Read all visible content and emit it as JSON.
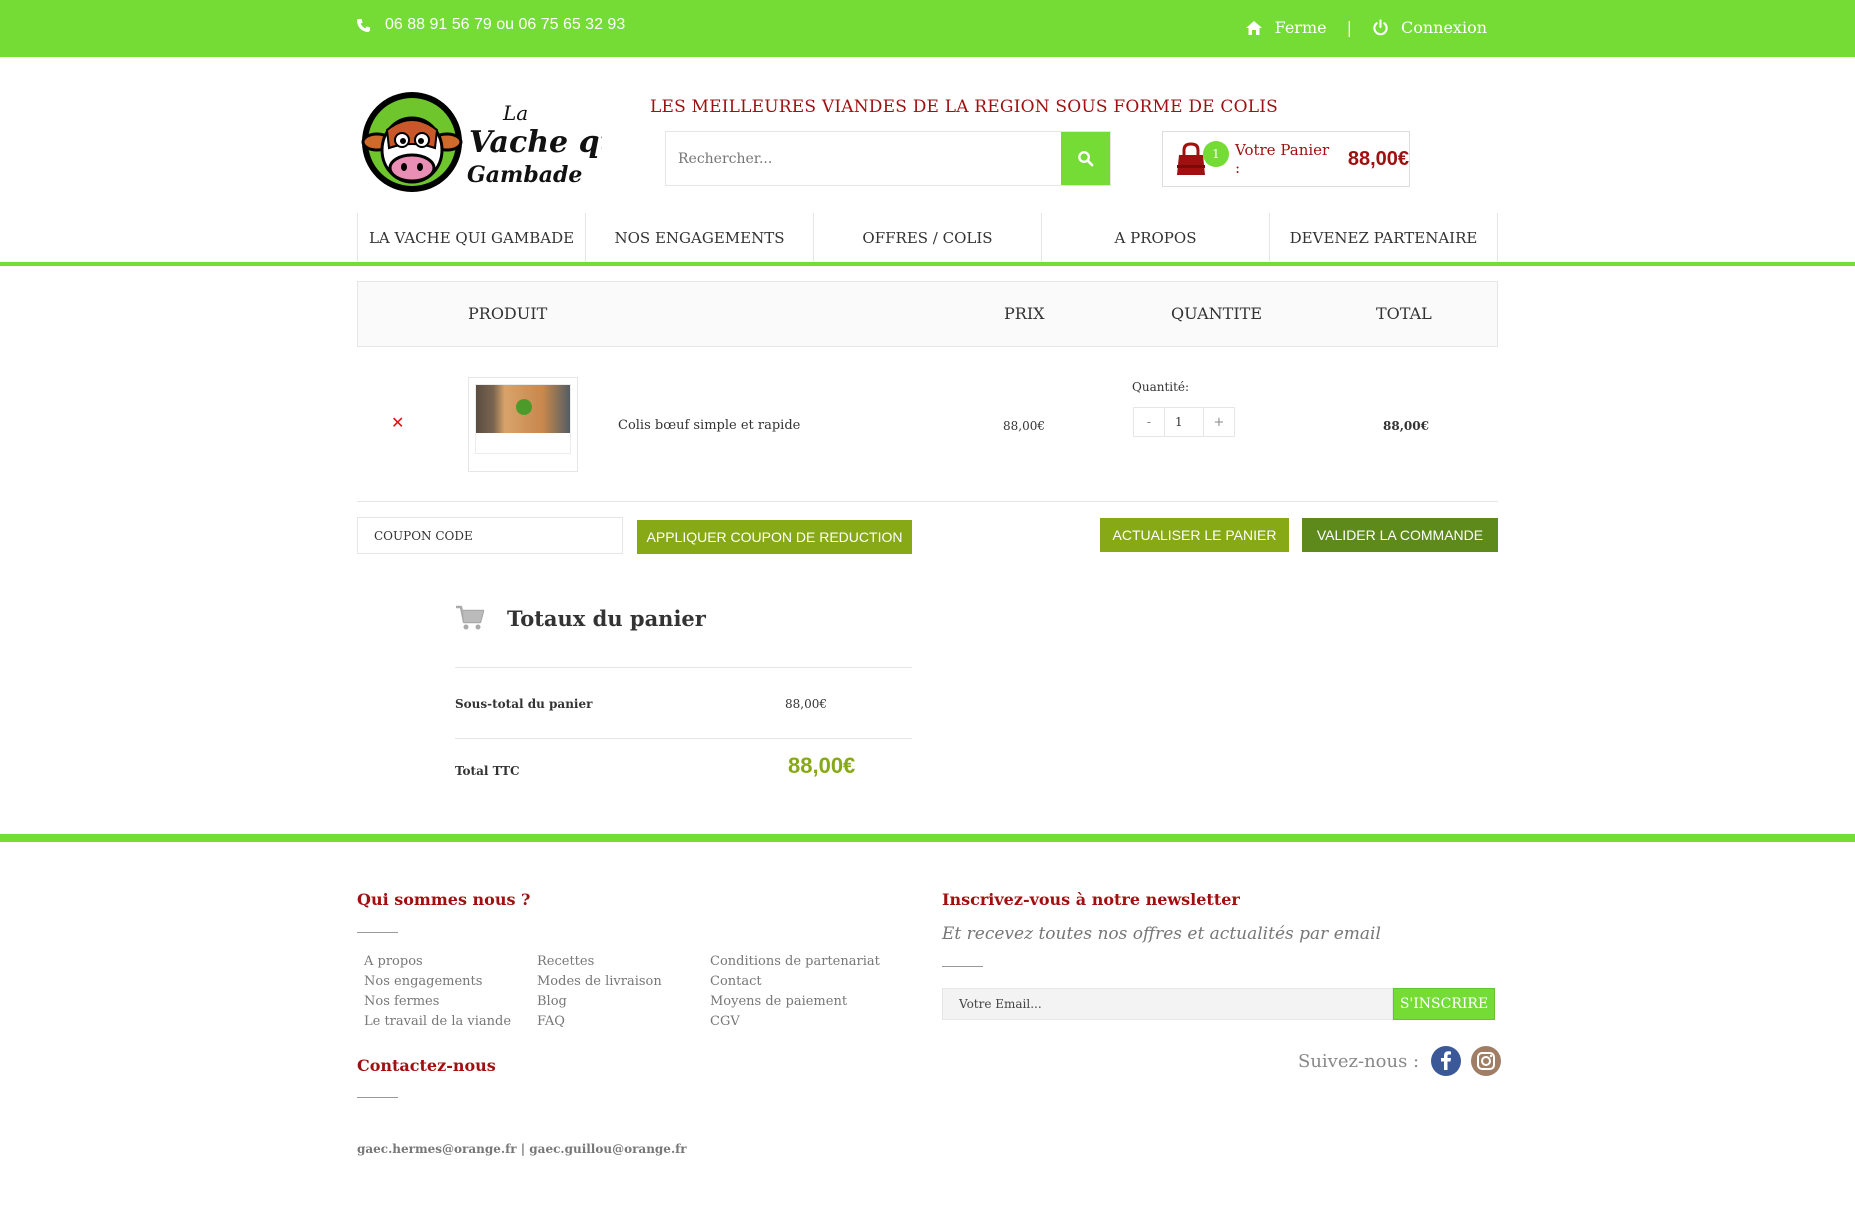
{
  "topbar": {
    "phone": "06 88 91 56 79 ou 06 75 65 32 93",
    "farm_link": "Ferme",
    "separator": "|",
    "login_link": "Connexion"
  },
  "header": {
    "logo_text": "La Vache qui Gambade",
    "tagline": "LES MEILLEURES VIANDES DE LA REGION SOUS FORME DE COLIS",
    "search_placeholder": "Rechercher...",
    "cart_count": "1",
    "cart_label": "Votre Panier :",
    "cart_amount": "88,00€"
  },
  "nav": [
    "LA VACHE QUI GAMBADE",
    "NOS ENGAGEMENTS",
    "OFFRES / COLIS",
    "A PROPOS",
    "DEVENEZ PARTENAIRE"
  ],
  "cart_table": {
    "headers": {
      "product": "PRODUIT",
      "price": "PRIX",
      "quantity": "QUANTITE",
      "total": "TOTAL"
    },
    "items": [
      {
        "name": "Colis bœuf simple et rapide",
        "price": "88,00€",
        "quantity_label": "Quantité:",
        "quantity": "1",
        "minus": "-",
        "plus": "+",
        "total": "88,00€"
      }
    ]
  },
  "actions": {
    "coupon_placeholder": "COUPON CODE",
    "apply_coupon": "APPLIQUER COUPON DE REDUCTION",
    "update_cart": "ACTUALISER LE PANIER",
    "validate_order": "VALIDER LA COMMANDE"
  },
  "totals": {
    "title": "Totaux du panier",
    "subtotal_label": "Sous-total du panier",
    "subtotal_value": "88,00€",
    "total_label": "Total TTC",
    "total_value": "88,00€"
  },
  "footer": {
    "about_title": "Qui sommes nous ?",
    "links_col1": [
      "A propos",
      "Nos engagements",
      "Nos fermes",
      "Le travail de la viande"
    ],
    "links_col2": [
      "Recettes",
      "Modes de livraison",
      "Blog",
      "FAQ"
    ],
    "links_col3": [
      "Conditions de partenariat",
      "Contact",
      "Moyens de paiement",
      "CGV"
    ],
    "contact_title": "Contactez-nous",
    "emails": "gaec.hermes@orange.fr | gaec.guillou@orange.fr",
    "newsletter_title": "Inscrivez-vous à notre newsletter",
    "newsletter_subtitle": "Et recevez toutes nos offres et actualités par email",
    "email_placeholder": "Votre Email...",
    "subscribe": "S'INSCRIRE",
    "follow": "Suivez-nous :"
  },
  "colors": {
    "brand_green": "#74dc34",
    "dark_red": "#a01010",
    "olive": "#87a915",
    "dark_green": "#5e8a1c"
  }
}
